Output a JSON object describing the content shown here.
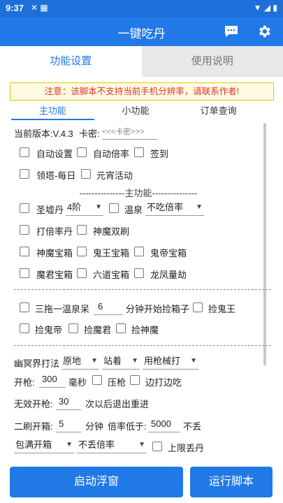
{
  "status_bar": {
    "time": "9:37"
  },
  "app_bar": {
    "title": "一键吃丹",
    "message_icon": "chat-bubble-icon",
    "settings_icon": "gear-icon"
  },
  "tabs": [
    {
      "label": "功能设置",
      "active": true
    },
    {
      "label": "使用说明",
      "active": false
    }
  ],
  "notice": "注意：该脚本不支持当前手机分辨率，请联系作者!",
  "sub_tabs": [
    {
      "label": "主功能",
      "active": true
    },
    {
      "label": "小功能",
      "active": false
    },
    {
      "label": "订单查询",
      "active": false
    }
  ],
  "version": {
    "label": "当前版本:V.4.3",
    "key_label": "卡密:",
    "key_placeholder": "<<<卡密>>>"
  },
  "checks_row1": [
    {
      "label": "自动设置",
      "checked": false
    },
    {
      "label": "自动倍率",
      "checked": false
    },
    {
      "label": "签到",
      "checked": false
    }
  ],
  "checks_row2": [
    {
      "label": "领塔-每日",
      "checked": false
    },
    {
      "label": "元宵活动",
      "checked": false
    }
  ],
  "main_section_title": "---------------主功能---------------",
  "shengxu": {
    "label": "圣墟丹",
    "select": "4阶",
    "wenquan_label": "温泉",
    "wenquan_select": "不吃倍率"
  },
  "checks_row4": [
    {
      "label": "打倍率丹",
      "checked": false
    },
    {
      "label": "神魔双刷",
      "checked": false
    }
  ],
  "checks_row5": [
    {
      "label": "神魔宝箱",
      "checked": false
    },
    {
      "label": "鬼王宝箱",
      "checked": false
    },
    {
      "label": "鬼帝宝箱",
      "checked": false
    }
  ],
  "checks_row6": [
    {
      "label": "魔君宝箱",
      "checked": false
    },
    {
      "label": "六道宝箱",
      "checked": false
    },
    {
      "label": "龙凤量劫",
      "checked": false
    }
  ],
  "three_drag": {
    "label": "三拖一温泉呆",
    "value": "6",
    "suffix": "分钟开始捡箱子",
    "check2": "捡鬼王"
  },
  "checks_row8": [
    {
      "label": "捡鬼帝",
      "checked": false
    },
    {
      "label": "捡魔君",
      "checked": false
    },
    {
      "label": "捡神魔",
      "checked": false
    }
  ],
  "youming": {
    "label": "幽冥界打法",
    "select1": "原地",
    "select2": "站着",
    "select3": "用枪械打"
  },
  "fire": {
    "label": "开枪:",
    "value": "300",
    "unit": "毫秒",
    "check1": "压枪",
    "check2": "边打边吃"
  },
  "invalid_fire": {
    "label": "无效开枪:",
    "value": "30",
    "suffix": "次以后退出重进"
  },
  "second_brush": {
    "label": "二刷开箱:",
    "value": "5",
    "unit": "分钟",
    "rate_label": "倍率低于:",
    "rate_value": "5000",
    "rate_suffix": "不丢"
  },
  "bag": {
    "select1": "包满开箱",
    "select2": "不丢倍率",
    "check": "上限丢丹"
  },
  "buttons": {
    "float": "启动浮窗",
    "run": "运行脚本"
  },
  "colors": {
    "primary": "#2079e6",
    "notice_text": "#e0342d",
    "notice_border": "#e8c800"
  }
}
